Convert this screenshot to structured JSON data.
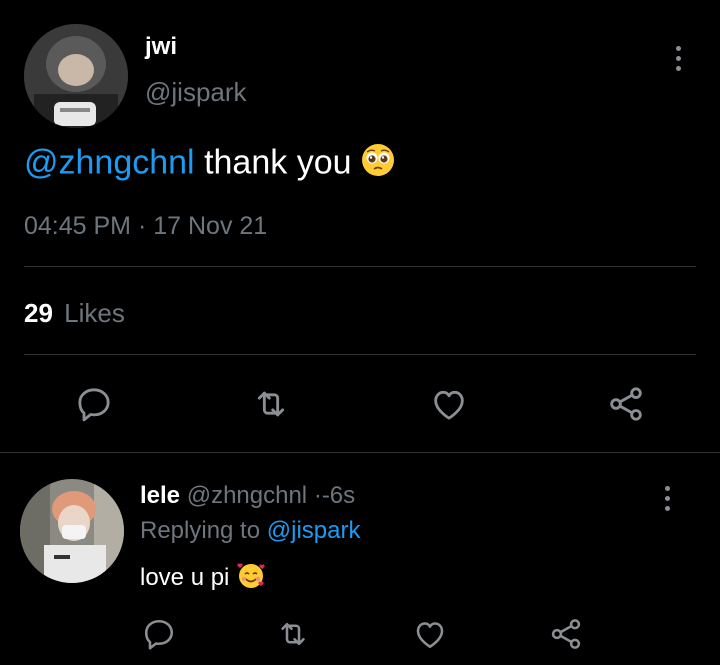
{
  "main_tweet": {
    "display_name": "jwi",
    "handle": "@jispark",
    "mention": "@zhngchnl",
    "text": " thank you",
    "emoji_icon": "pleading-face-emoji",
    "time": "04:45 PM",
    "separator": "·",
    "date": "17 Nov 21",
    "likes_count": "29",
    "likes_label": "Likes"
  },
  "reply": {
    "display_name": "lele",
    "handle": "@zhngchnl",
    "separator": "·",
    "age": "-6s",
    "replying_prefix": "Replying to",
    "replying_to": "@jispark",
    "text": "love u pi",
    "emoji_icon": "smiling-face-with-hearts-emoji"
  },
  "icons": [
    "reply-icon",
    "retweet-icon",
    "like-icon",
    "share-icon",
    "more-options-icon"
  ],
  "colors": {
    "background": "#000000",
    "link": "#1d9bf0",
    "muted": "#6e767d",
    "icon": "#8b8f94",
    "divider": "#2f3336"
  }
}
